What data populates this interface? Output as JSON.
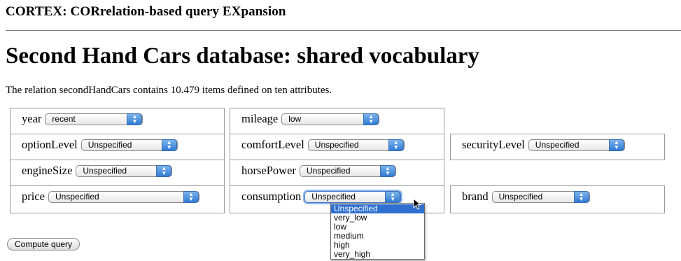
{
  "header": {
    "app_title": "CORTEX: CORrelation-based query EXpansion",
    "page_title": "Second Hand Cars database: shared vocabulary",
    "description": "The relation secondHandCars contains 10.479 items defined on ten attributes."
  },
  "attributes": {
    "year": {
      "label": "year",
      "value": "recent"
    },
    "mileage": {
      "label": "mileage",
      "value": "low"
    },
    "optionLevel": {
      "label": "optionLevel",
      "value": "Unspecified"
    },
    "comfortLevel": {
      "label": "comfortLevel",
      "value": "Unspecified"
    },
    "securityLevel": {
      "label": "securityLevel",
      "value": "Unspecified"
    },
    "engineSize": {
      "label": "engineSize",
      "value": "Unspecified"
    },
    "horsePower": {
      "label": "horsePower",
      "value": "Unspecified"
    },
    "price": {
      "label": "price",
      "value": "Unspecified"
    },
    "consumption": {
      "label": "consumption",
      "value": "Unspecified"
    },
    "brand": {
      "label": "brand",
      "value": "Unspecified"
    }
  },
  "consumption_dropdown": {
    "options": [
      "Unspecified",
      "very_low",
      "low",
      "medium",
      "high",
      "very_high"
    ],
    "selected": "Unspecified"
  },
  "actions": {
    "compute_label": "Compute query"
  },
  "colors": {
    "select_arrow": "#2f7bd6",
    "dropdown_highlight": "#2f6fcf",
    "cell_border": "#9a9a9a"
  }
}
